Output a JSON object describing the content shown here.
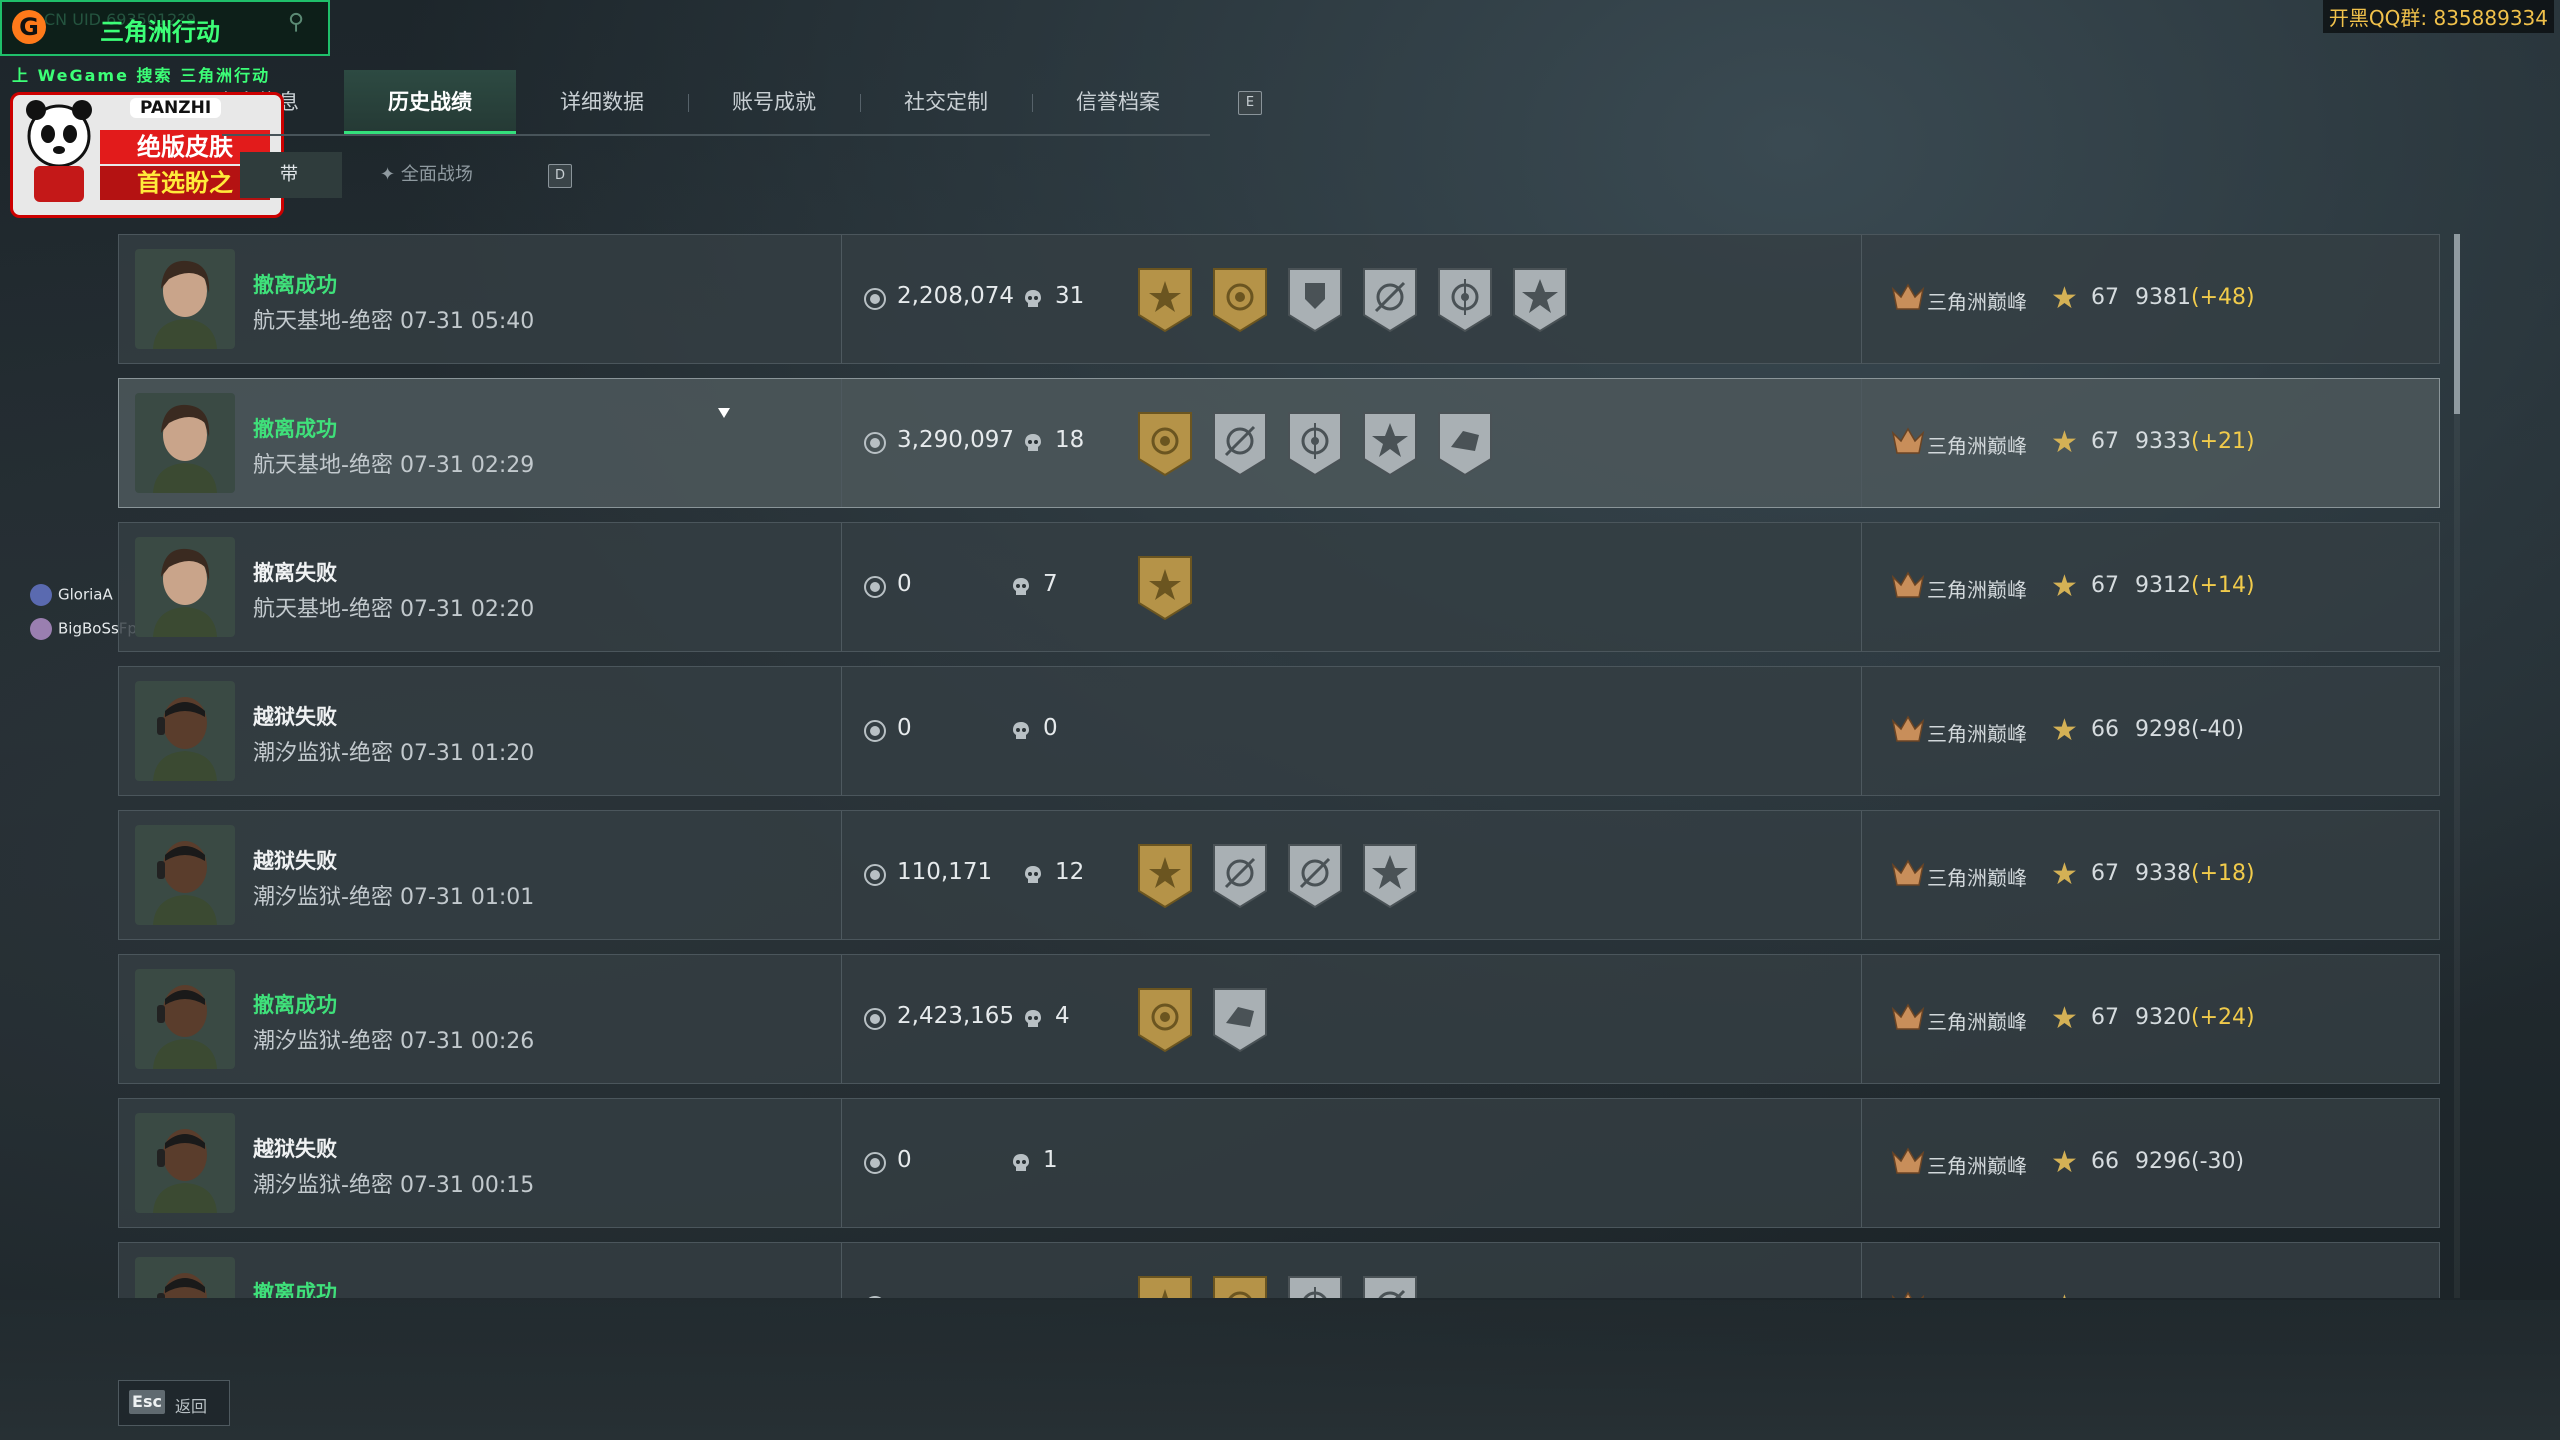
{
  "overlay": {
    "brand_icon": "G",
    "brand_title": "三角洲行动",
    "uid_label": "CN UID",
    "uid_value": "6935012?9",
    "wegame_line": "上 WeGame 搜索 三角洲行动",
    "ad_panzhi": "PANZHI",
    "ad_line1": "绝版皮肤",
    "ad_line2": "首选盼之",
    "qq_text": "开黑QQ群: 835889334"
  },
  "tabs": {
    "prefix_partial": "个人信息",
    "items": [
      {
        "label": "历史战绩",
        "active": true
      },
      {
        "label": "详细数据",
        "active": false
      },
      {
        "label": "账号成就",
        "active": false
      },
      {
        "label": "社交定制",
        "active": false
      },
      {
        "label": "信誉档案",
        "active": false
      }
    ],
    "key_hint": "E"
  },
  "subtabs": {
    "items": [
      {
        "label": "带",
        "active": true
      },
      {
        "label": "全面战场",
        "active": false
      }
    ],
    "key_hint": "D"
  },
  "matches": [
    {
      "status": "撤离成功",
      "result": "ok",
      "map": "航天基地-绝密",
      "time": "07-31 05:40",
      "value": "2,208,074",
      "kills": "31",
      "badges": [
        "gold-sun-badge",
        "gold-target-badge",
        "silver-shield-badge",
        "silver-crosshair-badge",
        "silver-eye-badge",
        "silver-star-badge"
      ],
      "rank": "三角洲巅峰",
      "level": "67",
      "score": "9381",
      "delta": "(+48)",
      "delta_sign": "pos"
    },
    {
      "status": "撤离成功",
      "result": "ok",
      "map": "航天基地-绝密",
      "time": "07-31 02:29",
      "value": "3,290,097",
      "kills": "18",
      "badges": [
        "gold-target-badge",
        "silver-crosshair-badge",
        "silver-eye-badge",
        "silver-star-badge",
        "silver-hand-badge"
      ],
      "rank": "三角洲巅峰",
      "level": "67",
      "score": "9333",
      "delta": "(+21)",
      "delta_sign": "pos"
    },
    {
      "status": "撤离失败",
      "result": "fail",
      "map": "航天基地-绝密",
      "time": "07-31 02:20",
      "value": "0",
      "kills": "7",
      "badges": [
        "gold-sun-badge"
      ],
      "rank": "三角洲巅峰",
      "level": "67",
      "score": "9312",
      "delta": "(+14)",
      "delta_sign": "pos"
    },
    {
      "status": "越狱失败",
      "result": "fail",
      "map": "潮汐监狱-绝密",
      "time": "07-31 01:20",
      "value": "0",
      "kills": "0",
      "badges": [],
      "rank": "三角洲巅峰",
      "level": "66",
      "score": "9298",
      "delta": "(-40)",
      "delta_sign": "neg"
    },
    {
      "status": "越狱失败",
      "result": "fail",
      "map": "潮汐监狱-绝密",
      "time": "07-31 01:01",
      "value": "110,171",
      "kills": "12",
      "badges": [
        "gold-sun-badge",
        "silver-crosshair-badge",
        "silver-crosshair-badge",
        "silver-star-badge"
      ],
      "rank": "三角洲巅峰",
      "level": "67",
      "score": "9338",
      "delta": "(+18)",
      "delta_sign": "pos"
    },
    {
      "status": "撤离成功",
      "result": "ok",
      "map": "潮汐监狱-绝密",
      "time": "07-31 00:26",
      "value": "2,423,165",
      "kills": "4",
      "badges": [
        "gold-target-badge",
        "silver-hand-badge"
      ],
      "rank": "三角洲巅峰",
      "level": "67",
      "score": "9320",
      "delta": "(+24)",
      "delta_sign": "pos"
    },
    {
      "status": "越狱失败",
      "result": "fail",
      "map": "潮汐监狱-绝密",
      "time": "07-31 00:15",
      "value": "0",
      "kills": "1",
      "badges": [],
      "rank": "三角洲巅峰",
      "level": "66",
      "score": "9296",
      "delta": "(-30)",
      "delta_sign": "neg"
    },
    {
      "status": "撤离成功",
      "result": "ok",
      "map": "",
      "time": "",
      "value": "",
      "kills": "",
      "badges": [
        "gold-sun-badge",
        "gold-target-badge",
        "silver-eye-badge",
        "silver-crosshair-badge"
      ],
      "rank": "",
      "level": "",
      "score": "",
      "delta": "",
      "delta_sign": "pos"
    }
  ],
  "viewers": [
    {
      "name": "GloriaA"
    },
    {
      "name": "BigBoSsFps"
    }
  ],
  "footer": {
    "esc_key": "Esc",
    "esc_label": "返回"
  },
  "colors": {
    "success_green": "#3fe07a",
    "delta_gold": "#f1cb4b",
    "tab_accent": "#34e07c"
  }
}
